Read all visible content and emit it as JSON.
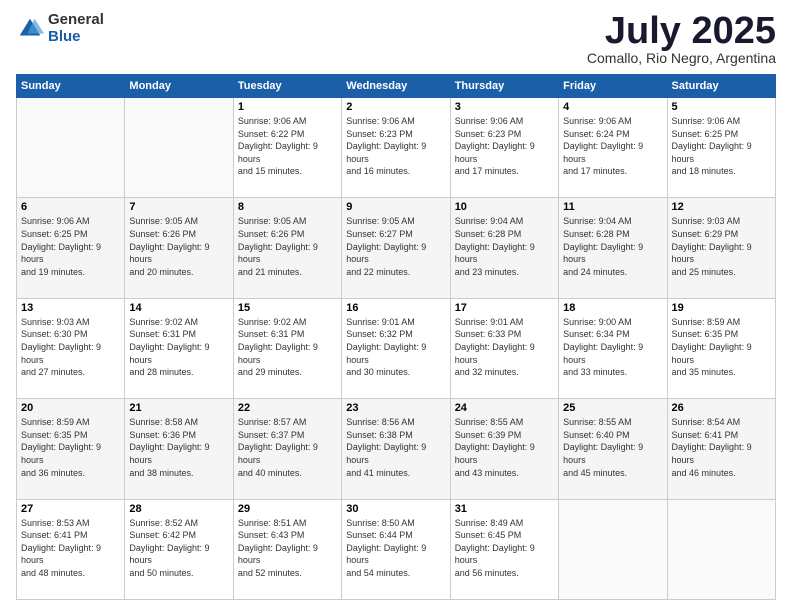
{
  "logo": {
    "general": "General",
    "blue": "Blue"
  },
  "title": "July 2025",
  "subtitle": "Comallo, Rio Negro, Argentina",
  "days_of_week": [
    "Sunday",
    "Monday",
    "Tuesday",
    "Wednesday",
    "Thursday",
    "Friday",
    "Saturday"
  ],
  "weeks": [
    [
      {
        "day": "",
        "sunrise": "",
        "sunset": "",
        "daylight": ""
      },
      {
        "day": "",
        "sunrise": "",
        "sunset": "",
        "daylight": ""
      },
      {
        "day": "1",
        "sunrise": "Sunrise: 9:06 AM",
        "sunset": "Sunset: 6:22 PM",
        "daylight": "Daylight: 9 hours and 15 minutes."
      },
      {
        "day": "2",
        "sunrise": "Sunrise: 9:06 AM",
        "sunset": "Sunset: 6:23 PM",
        "daylight": "Daylight: 9 hours and 16 minutes."
      },
      {
        "day": "3",
        "sunrise": "Sunrise: 9:06 AM",
        "sunset": "Sunset: 6:23 PM",
        "daylight": "Daylight: 9 hours and 17 minutes."
      },
      {
        "day": "4",
        "sunrise": "Sunrise: 9:06 AM",
        "sunset": "Sunset: 6:24 PM",
        "daylight": "Daylight: 9 hours and 17 minutes."
      },
      {
        "day": "5",
        "sunrise": "Sunrise: 9:06 AM",
        "sunset": "Sunset: 6:25 PM",
        "daylight": "Daylight: 9 hours and 18 minutes."
      }
    ],
    [
      {
        "day": "6",
        "sunrise": "Sunrise: 9:06 AM",
        "sunset": "Sunset: 6:25 PM",
        "daylight": "Daylight: 9 hours and 19 minutes."
      },
      {
        "day": "7",
        "sunrise": "Sunrise: 9:05 AM",
        "sunset": "Sunset: 6:26 PM",
        "daylight": "Daylight: 9 hours and 20 minutes."
      },
      {
        "day": "8",
        "sunrise": "Sunrise: 9:05 AM",
        "sunset": "Sunset: 6:26 PM",
        "daylight": "Daylight: 9 hours and 21 minutes."
      },
      {
        "day": "9",
        "sunrise": "Sunrise: 9:05 AM",
        "sunset": "Sunset: 6:27 PM",
        "daylight": "Daylight: 9 hours and 22 minutes."
      },
      {
        "day": "10",
        "sunrise": "Sunrise: 9:04 AM",
        "sunset": "Sunset: 6:28 PM",
        "daylight": "Daylight: 9 hours and 23 minutes."
      },
      {
        "day": "11",
        "sunrise": "Sunrise: 9:04 AM",
        "sunset": "Sunset: 6:28 PM",
        "daylight": "Daylight: 9 hours and 24 minutes."
      },
      {
        "day": "12",
        "sunrise": "Sunrise: 9:03 AM",
        "sunset": "Sunset: 6:29 PM",
        "daylight": "Daylight: 9 hours and 25 minutes."
      }
    ],
    [
      {
        "day": "13",
        "sunrise": "Sunrise: 9:03 AM",
        "sunset": "Sunset: 6:30 PM",
        "daylight": "Daylight: 9 hours and 27 minutes."
      },
      {
        "day": "14",
        "sunrise": "Sunrise: 9:02 AM",
        "sunset": "Sunset: 6:31 PM",
        "daylight": "Daylight: 9 hours and 28 minutes."
      },
      {
        "day": "15",
        "sunrise": "Sunrise: 9:02 AM",
        "sunset": "Sunset: 6:31 PM",
        "daylight": "Daylight: 9 hours and 29 minutes."
      },
      {
        "day": "16",
        "sunrise": "Sunrise: 9:01 AM",
        "sunset": "Sunset: 6:32 PM",
        "daylight": "Daylight: 9 hours and 30 minutes."
      },
      {
        "day": "17",
        "sunrise": "Sunrise: 9:01 AM",
        "sunset": "Sunset: 6:33 PM",
        "daylight": "Daylight: 9 hours and 32 minutes."
      },
      {
        "day": "18",
        "sunrise": "Sunrise: 9:00 AM",
        "sunset": "Sunset: 6:34 PM",
        "daylight": "Daylight: 9 hours and 33 minutes."
      },
      {
        "day": "19",
        "sunrise": "Sunrise: 8:59 AM",
        "sunset": "Sunset: 6:35 PM",
        "daylight": "Daylight: 9 hours and 35 minutes."
      }
    ],
    [
      {
        "day": "20",
        "sunrise": "Sunrise: 8:59 AM",
        "sunset": "Sunset: 6:35 PM",
        "daylight": "Daylight: 9 hours and 36 minutes."
      },
      {
        "day": "21",
        "sunrise": "Sunrise: 8:58 AM",
        "sunset": "Sunset: 6:36 PM",
        "daylight": "Daylight: 9 hours and 38 minutes."
      },
      {
        "day": "22",
        "sunrise": "Sunrise: 8:57 AM",
        "sunset": "Sunset: 6:37 PM",
        "daylight": "Daylight: 9 hours and 40 minutes."
      },
      {
        "day": "23",
        "sunrise": "Sunrise: 8:56 AM",
        "sunset": "Sunset: 6:38 PM",
        "daylight": "Daylight: 9 hours and 41 minutes."
      },
      {
        "day": "24",
        "sunrise": "Sunrise: 8:55 AM",
        "sunset": "Sunset: 6:39 PM",
        "daylight": "Daylight: 9 hours and 43 minutes."
      },
      {
        "day": "25",
        "sunrise": "Sunrise: 8:55 AM",
        "sunset": "Sunset: 6:40 PM",
        "daylight": "Daylight: 9 hours and 45 minutes."
      },
      {
        "day": "26",
        "sunrise": "Sunrise: 8:54 AM",
        "sunset": "Sunset: 6:41 PM",
        "daylight": "Daylight: 9 hours and 46 minutes."
      }
    ],
    [
      {
        "day": "27",
        "sunrise": "Sunrise: 8:53 AM",
        "sunset": "Sunset: 6:41 PM",
        "daylight": "Daylight: 9 hours and 48 minutes."
      },
      {
        "day": "28",
        "sunrise": "Sunrise: 8:52 AM",
        "sunset": "Sunset: 6:42 PM",
        "daylight": "Daylight: 9 hours and 50 minutes."
      },
      {
        "day": "29",
        "sunrise": "Sunrise: 8:51 AM",
        "sunset": "Sunset: 6:43 PM",
        "daylight": "Daylight: 9 hours and 52 minutes."
      },
      {
        "day": "30",
        "sunrise": "Sunrise: 8:50 AM",
        "sunset": "Sunset: 6:44 PM",
        "daylight": "Daylight: 9 hours and 54 minutes."
      },
      {
        "day": "31",
        "sunrise": "Sunrise: 8:49 AM",
        "sunset": "Sunset: 6:45 PM",
        "daylight": "Daylight: 9 hours and 56 minutes."
      },
      {
        "day": "",
        "sunrise": "",
        "sunset": "",
        "daylight": ""
      },
      {
        "day": "",
        "sunrise": "",
        "sunset": "",
        "daylight": ""
      }
    ]
  ]
}
